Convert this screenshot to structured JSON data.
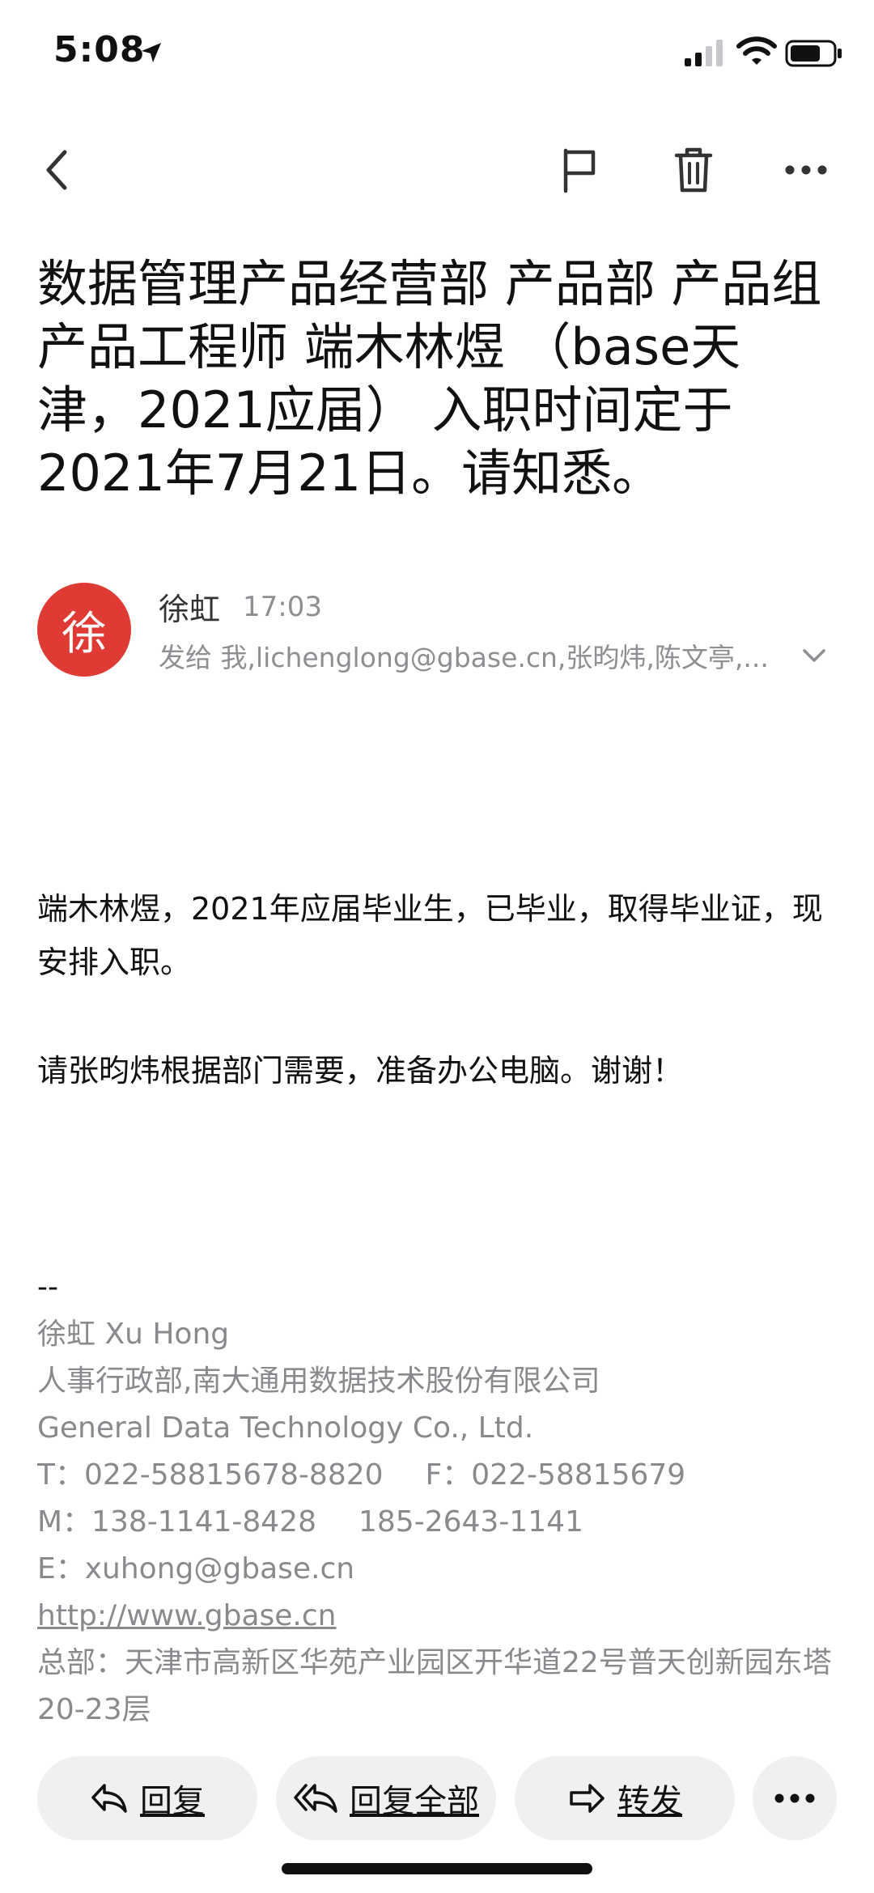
{
  "status_bar": {
    "time": "5:08",
    "icons": [
      "location-arrow-icon",
      "cellular-signal-icon",
      "wifi-icon",
      "battery-icon"
    ]
  },
  "toolbar": {
    "icons": [
      "back-chevron-icon",
      "flag-icon",
      "trash-icon",
      "more-icon"
    ]
  },
  "email": {
    "subject": "数据管理产品经营部 产品部 产品组 产品工程师 端木林煜 （base天津，2021应届） 入职时间定于2021年7月21日。请知悉。",
    "sender": {
      "avatar_text": "徐",
      "avatar_color": "#e03a34",
      "name": "徐虹",
      "time": "17:03",
      "recipients": "发给 我,lichenglong@gbase.cn,张昀炜,陈文亭,..."
    },
    "body": [
      "端木林煜，2021年应届毕业生，已毕业，取得毕业证，现安排入职。",
      "请张昀炜根据部门需要，准备办公电脑。谢谢！"
    ],
    "signature": {
      "dash": "--",
      "name": "徐虹 Xu Hong",
      "dept": "人事行政部,南大通用数据技术股份有限公司",
      "company_en": "General Data Technology Co., Ltd.",
      "tel": "T：022-58815678-8820",
      "fax": "F：022-58815679",
      "mobile1": "M：138-1141-8428",
      "mobile2": "185-2643-1141",
      "email": "E：xuhong@gbase.cn",
      "url": "http://www.gbase.cn",
      "address": "总部：天津市高新区华苑产业园区开华道22号普天创新园东塔20-23层"
    }
  },
  "actions": {
    "reply": "回复",
    "reply_all": "回复全部",
    "forward": "转发",
    "more_icon": "more-icon"
  }
}
